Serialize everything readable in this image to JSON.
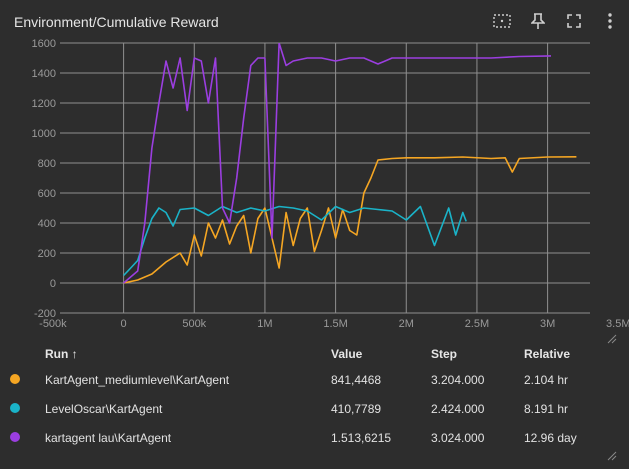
{
  "header": {
    "title": "Environment/Cumulative Reward"
  },
  "toolbar": [
    "fit-domain-icon",
    "pin-icon",
    "fullscreen-icon",
    "more-vert-icon"
  ],
  "table": {
    "headers": {
      "run": "Run ↑",
      "value": "Value",
      "step": "Step",
      "relative": "Relative"
    },
    "rows": [
      {
        "run": "KartAgent_mediumlevel\\KartAgent",
        "value": "841,4468",
        "step": "3.204.000",
        "relative": "2.104 hr",
        "color": "#f5a623"
      },
      {
        "run": "LevelOscar\\KartAgent",
        "value": "410,7789",
        "step": "2.424.000",
        "relative": "8.191 hr",
        "color": "#1ab3c8"
      },
      {
        "run": "kartagent lau\\KartAgent",
        "value": "1.513,6215",
        "step": "3.024.000",
        "relative": "12.96 day",
        "color": "#9b3ee0"
      }
    ]
  },
  "chart_data": {
    "type": "line",
    "title": "Environment/Cumulative Reward",
    "xlabel": "",
    "ylabel": "",
    "xlim": [
      -450000,
      3300000
    ],
    "ylim": [
      -200,
      1600
    ],
    "x_ticks": [
      -500000,
      0,
      500000,
      1000000,
      1500000,
      2000000,
      2500000,
      3000000,
      3500000
    ],
    "x_tick_labels": [
      "-500k",
      "0",
      "500k",
      "1M",
      "1.5M",
      "2M",
      "2.5M",
      "3M",
      "3.5M"
    ],
    "y_ticks": [
      -200,
      0,
      200,
      400,
      600,
      800,
      1000,
      1200,
      1400,
      1600
    ],
    "y_tick_labels": [
      "-200",
      "0",
      "200",
      "400",
      "600",
      "800",
      "1000",
      "1200",
      "1400",
      "1600"
    ],
    "grid": true,
    "series": [
      {
        "name": "KartAgent_mediumlevel\\KartAgent",
        "color": "#f5a623",
        "x": [
          0,
          100000,
          200000,
          300000,
          400000,
          450000,
          500000,
          550000,
          600000,
          650000,
          700000,
          750000,
          800000,
          850000,
          900000,
          950000,
          1000000,
          1050000,
          1100000,
          1150000,
          1200000,
          1250000,
          1300000,
          1350000,
          1400000,
          1450000,
          1500000,
          1550000,
          1600000,
          1650000,
          1700000,
          1750000,
          1800000,
          1900000,
          2000000,
          2200000,
          2400000,
          2600000,
          2700000,
          2750000,
          2800000,
          3000000,
          3204000
        ],
        "y": [
          0,
          20,
          60,
          140,
          200,
          120,
          320,
          180,
          400,
          300,
          420,
          260,
          380,
          450,
          200,
          430,
          500,
          300,
          100,
          470,
          250,
          430,
          500,
          210,
          350,
          500,
          300,
          490,
          350,
          320,
          600,
          700,
          820,
          830,
          835,
          835,
          840,
          830,
          835,
          740,
          830,
          840,
          841
        ]
      },
      {
        "name": "LevelOscar\\KartAgent",
        "color": "#1ab3c8",
        "x": [
          0,
          50000,
          100000,
          150000,
          200000,
          250000,
          300000,
          350000,
          400000,
          500000,
          600000,
          700000,
          800000,
          900000,
          1000000,
          1100000,
          1200000,
          1300000,
          1400000,
          1500000,
          1600000,
          1700000,
          1800000,
          1900000,
          2000000,
          2100000,
          2200000,
          2300000,
          2350000,
          2400000,
          2424000
        ],
        "y": [
          50,
          100,
          150,
          300,
          430,
          500,
          470,
          380,
          490,
          500,
          450,
          510,
          470,
          500,
          480,
          510,
          500,
          480,
          420,
          510,
          470,
          500,
          490,
          480,
          420,
          510,
          250,
          500,
          320,
          470,
          411
        ]
      },
      {
        "name": "kartagent lau\\KartAgent",
        "color": "#9b3ee0",
        "x": [
          0,
          100000,
          150000,
          200000,
          250000,
          300000,
          350000,
          400000,
          450000,
          500000,
          550000,
          600000,
          650000,
          700000,
          750000,
          800000,
          850000,
          900000,
          950000,
          1000000,
          1050000,
          1100000,
          1150000,
          1200000,
          1300000,
          1400000,
          1500000,
          1600000,
          1700000,
          1800000,
          1900000,
          2000000,
          2200000,
          2400000,
          2600000,
          2800000,
          3024000
        ],
        "y": [
          0,
          80,
          400,
          900,
          1200,
          1480,
          1300,
          1500,
          1150,
          1500,
          1480,
          1200,
          1500,
          500,
          400,
          700,
          1100,
          1450,
          1500,
          1500,
          300,
          1600,
          1450,
          1480,
          1500,
          1500,
          1480,
          1500,
          1500,
          1460,
          1500,
          1500,
          1500,
          1500,
          1500,
          1510,
          1514
        ]
      }
    ]
  }
}
